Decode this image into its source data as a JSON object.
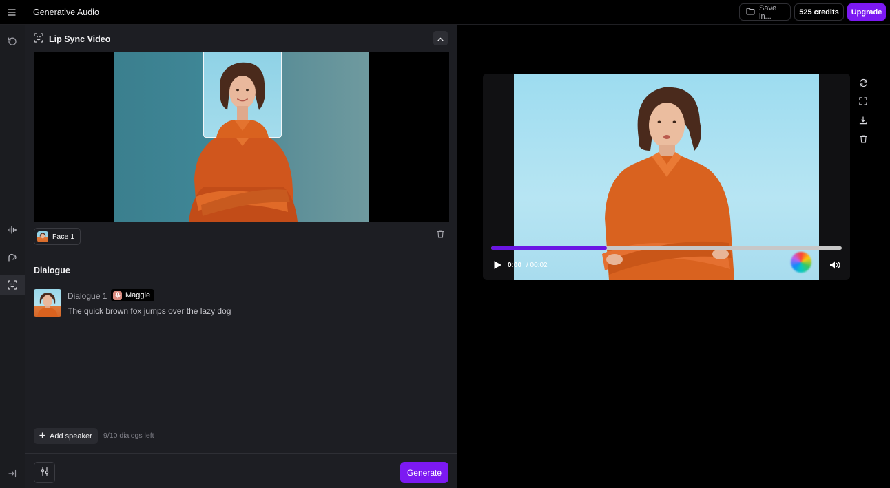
{
  "topbar": {
    "menu_icon": "hamburger-menu-icon",
    "app_title": "Generative Audio",
    "save_label": "Save in...",
    "credits_label": "525 credits",
    "upgrade_label": "Upgrade"
  },
  "rail": {
    "items": [
      {
        "icon": "history-icon"
      },
      {
        "icon": "waveform-icon"
      },
      {
        "icon": "voice-speaking-icon"
      },
      {
        "icon": "face-scan-icon",
        "active": true
      },
      {
        "icon": "collapse-sidebar-icon"
      }
    ]
  },
  "lipsync": {
    "title": "Lip Sync Video",
    "face_label": "Face 1"
  },
  "dialogue": {
    "title": "Dialogue",
    "items": [
      {
        "name": "Dialogue 1",
        "speaker": "Maggie",
        "text": "The quick brown fox jumps over the lazy dog"
      }
    ],
    "add_speaker_label": "Add speaker",
    "dialogs_left": "9/10 dialogs left"
  },
  "footer": {
    "generate_label": "Generate"
  },
  "player": {
    "current_time": "0:00",
    "total_time": "/ 00:02",
    "progress_percent": 33
  },
  "colors": {
    "accent": "#7c19f2",
    "panel_bg": "#1d1e23",
    "rail_bg": "#1b1c20",
    "shirt": "#d9621f"
  }
}
